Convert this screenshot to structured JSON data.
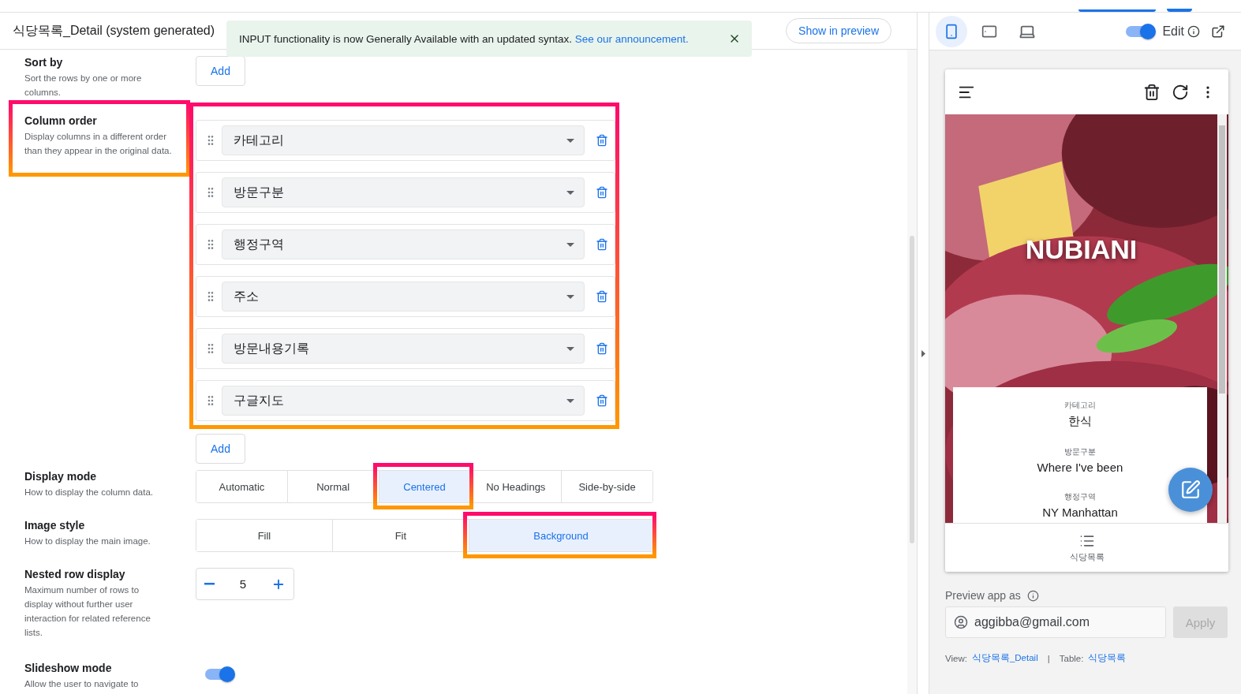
{
  "header": {
    "title": "식당목록_Detail (system generated)",
    "show_in_preview": "Show in preview"
  },
  "banner": {
    "message": "INPUT functionality is now Generally Available with an updated syntax.",
    "link": "See our announcement."
  },
  "settings": [
    {
      "kind": "add",
      "label": "Sort by",
      "description": "Sort the rows by one or more columns.",
      "button": "Add",
      "highlighted": false
    },
    {
      "kind": "column_order",
      "label": "Column order",
      "description": "Display columns in a different order than they appear in the original data.",
      "highlighted": true,
      "columns": [
        "카테고리",
        "방문구분",
        "행정구역",
        "주소",
        "방문내용기록",
        "구글지도"
      ],
      "button": "Add"
    },
    {
      "kind": "segmented",
      "label": "Display mode",
      "description": "How to display the column data.",
      "highlighted": false,
      "options": [
        {
          "label": "Automatic",
          "selected": false,
          "highlighted": false
        },
        {
          "label": "Normal",
          "selected": false,
          "highlighted": false
        },
        {
          "label": "Centered",
          "selected": true,
          "highlighted": true
        },
        {
          "label": "No Headings",
          "selected": false,
          "highlighted": false
        },
        {
          "label": "Side-by-side",
          "selected": false,
          "highlighted": false
        }
      ]
    },
    {
      "kind": "segmented",
      "label": "Image style",
      "description": "How to display the main image.",
      "highlighted": false,
      "options": [
        {
          "label": "Fill",
          "selected": false,
          "highlighted": false
        },
        {
          "label": "Fit",
          "selected": false,
          "highlighted": false
        },
        {
          "label": "Background",
          "selected": true,
          "highlighted": true
        }
      ]
    },
    {
      "kind": "stepper",
      "label": "Nested row display",
      "description": "Maximum number of rows to display without further user interaction for related reference lists.",
      "highlighted": false,
      "value": "5"
    },
    {
      "kind": "toggle",
      "label": "Slideshow mode",
      "description": "Allow the user to navigate to",
      "highlighted": false,
      "on": true
    }
  ],
  "preview": {
    "device_modes": [
      {
        "kind": "phone",
        "selected": true
      },
      {
        "kind": "tablet",
        "selected": false
      },
      {
        "kind": "desktop",
        "selected": false
      }
    ],
    "edit": {
      "label": "Edit",
      "on": true
    },
    "app": {
      "title": "NUBIANI",
      "fields": [
        {
          "label": "카테고리",
          "value": "한식"
        },
        {
          "label": "방문구분",
          "value": "Where I've been"
        },
        {
          "label": "행정구역",
          "value": "NY Manhattan"
        }
      ],
      "nav_item": "식당목록"
    },
    "preview_as": {
      "label": "Preview app as",
      "value": "aggibba@gmail.com",
      "button": "Apply"
    },
    "footer": {
      "view_label": "View:",
      "view": "식당목록_Detail",
      "separator": "|",
      "table_label": "Table:",
      "table": "식당목록"
    }
  }
}
